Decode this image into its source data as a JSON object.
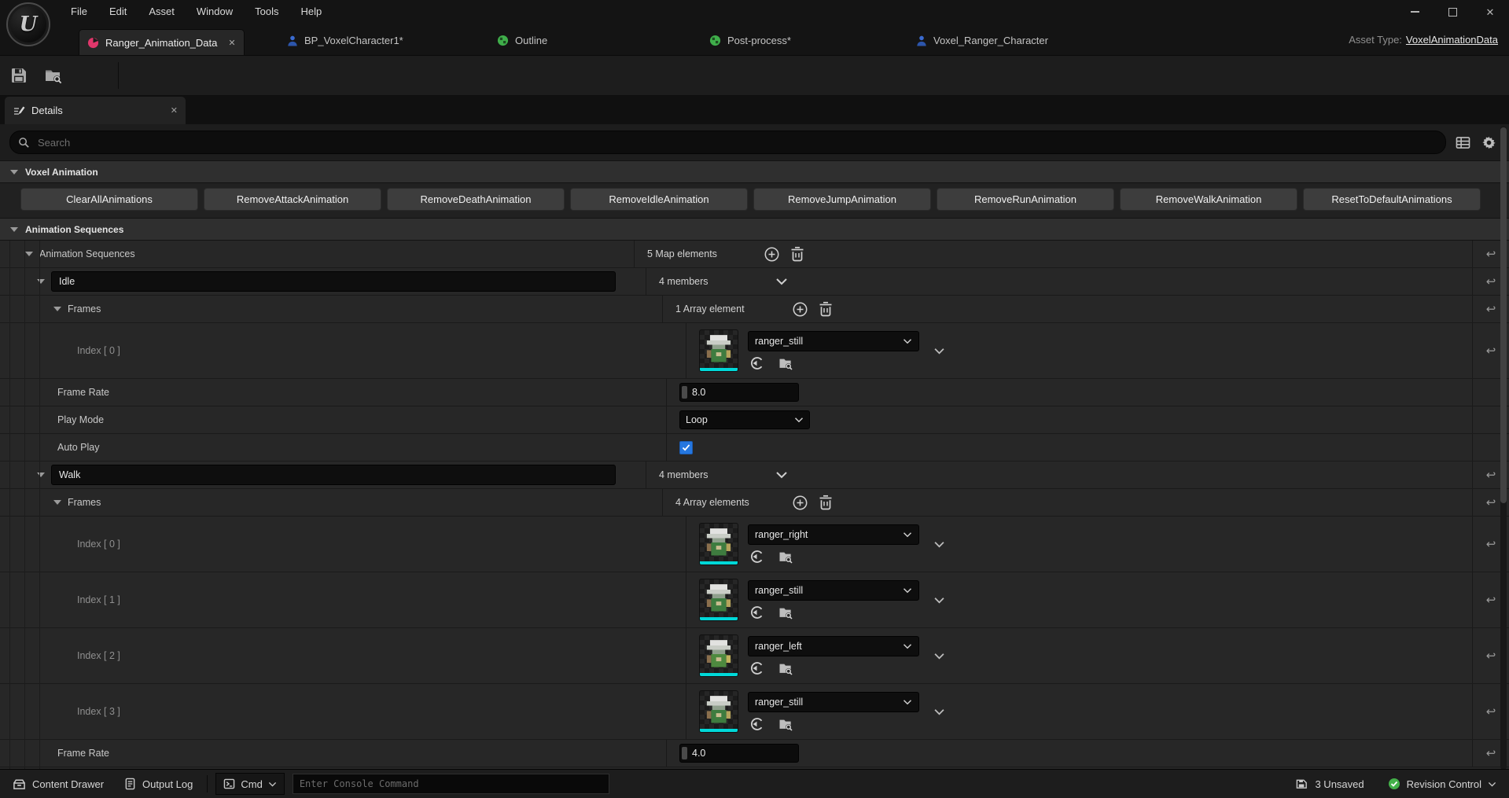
{
  "window": {
    "menu": [
      "File",
      "Edit",
      "Asset",
      "Window",
      "Tools",
      "Help"
    ],
    "asset_type_label": "Asset Type:",
    "asset_type_value": "VoxelAnimationData"
  },
  "tabs": {
    "t0": "Ranger_Animation_Data",
    "t1": "BP_VoxelCharacter1*",
    "t2": "Outline",
    "t3": "Post-process*",
    "t4": "Voxel_Ranger_Character"
  },
  "details": {
    "tab_label": "Details",
    "search_placeholder": "Search"
  },
  "voxel_animation": {
    "title": "Voxel Animation",
    "buttons": [
      "ClearAllAnimations",
      "RemoveAttackAnimation",
      "RemoveDeathAnimation",
      "RemoveIdleAnimation",
      "RemoveJumpAnimation",
      "RemoveRunAnimation",
      "RemoveWalkAnimation",
      "ResetToDefaultAnimations"
    ]
  },
  "sequences": {
    "title": "Animation Sequences",
    "map_label": "Animation Sequences",
    "map_value": "5 Map elements",
    "idle": {
      "name": "Idle",
      "members": "4 members",
      "frames_label": "Frames",
      "frames_value": "1 Array element",
      "frame0_label": "Index [ 0 ]",
      "frame0_asset": "ranger_still",
      "frame_rate_label": "Frame Rate",
      "frame_rate": "8.0",
      "play_mode_label": "Play Mode",
      "play_mode": "Loop",
      "auto_play_label": "Auto Play",
      "auto_play_checked": true
    },
    "walk": {
      "name": "Walk",
      "members": "4 members",
      "frames_label": "Frames",
      "frames_value": "4 Array elements",
      "frame0_label": "Index [ 0 ]",
      "frame0_asset": "ranger_right",
      "frame1_label": "Index [ 1 ]",
      "frame1_asset": "ranger_still",
      "frame2_label": "Index [ 2 ]",
      "frame2_asset": "ranger_left",
      "frame3_label": "Index [ 3 ]",
      "frame3_asset": "ranger_still",
      "frame_rate_label": "Frame Rate",
      "frame_rate": "4.0"
    }
  },
  "status_bar": {
    "content_drawer": "Content Drawer",
    "output_log": "Output Log",
    "cmd": "Cmd",
    "console_placeholder": "Enter Console Command",
    "unsaved": "3 Unsaved",
    "revision_control": "Revision Control"
  },
  "icons": {
    "search": "magnifier",
    "display_filter": "table-grid",
    "settings": "gear",
    "add_element": "circle-plus",
    "delete_elements": "trash-can",
    "reset_to_default": "undo-arrow",
    "expand": "chevron-down",
    "use_selected_asset": "circle-arrow-left",
    "browse_to_asset": "folder-magnifier",
    "save": "floppy-disk",
    "animation_asset_tab": "pink-pie",
    "blueprint_tab": "blue-person",
    "level_tab": "green-sphere"
  },
  "colors": {
    "accent_blue": "#2577e0",
    "thumbnail_bar_cyan": "#00d8d8",
    "asset_tab_pink": "#e0376b",
    "level_icon_green": "#3fae4a",
    "person_icon_blue": "#3a6bd0",
    "revision_green": "#43b049"
  }
}
